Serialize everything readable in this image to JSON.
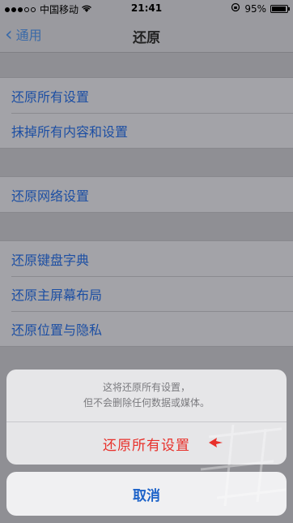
{
  "status_bar": {
    "carrier": "中国移动",
    "time": "21:41",
    "battery": "95%",
    "battery_level": 0.95,
    "signal_bars_filled": 3,
    "signal_bars_total": 5
  },
  "nav": {
    "back_label": "通用",
    "title": "还原"
  },
  "groups": [
    {
      "items": [
        "还原所有设置",
        "抹掉所有内容和设置"
      ]
    },
    {
      "items": [
        "还原网络设置"
      ]
    },
    {
      "items": [
        "还原键盘字典",
        "还原主屏幕布局",
        "还原位置与隐私"
      ]
    }
  ],
  "sheet": {
    "message_line1": "这将还原所有设置，",
    "message_line2": "但不会删除任何数据或媒体。",
    "destructive_label": "还原所有设置",
    "cancel_label": "取消"
  },
  "colors": {
    "link": "#1d4fa3",
    "destructive": "#e8302a",
    "cancel": "#1d63c9"
  }
}
